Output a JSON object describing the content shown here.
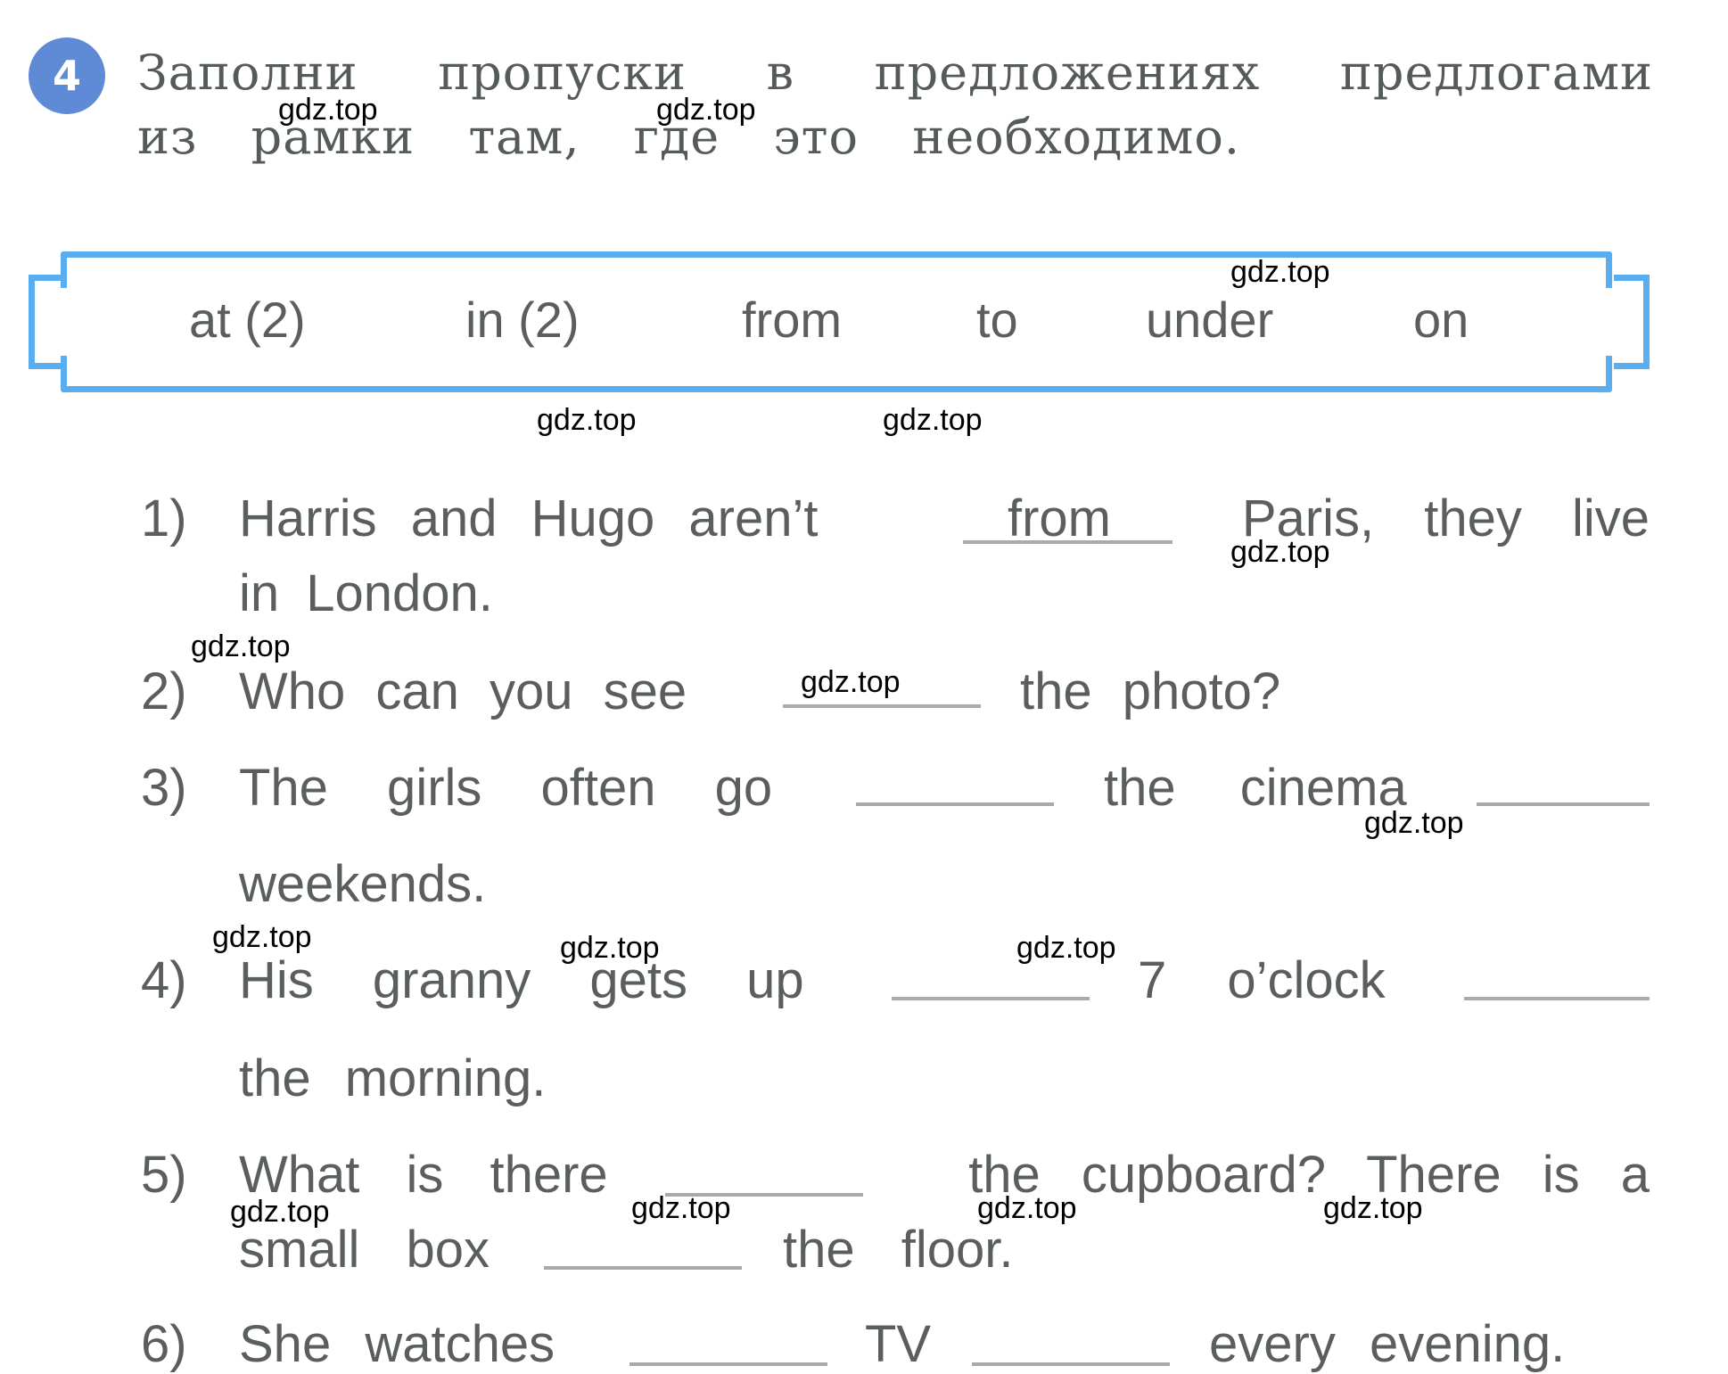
{
  "exercise": {
    "number": "4",
    "instruction_line1": [
      "Заполни",
      "пропуски",
      "в",
      "предложениях",
      "предлогами"
    ],
    "instruction_line2": [
      "из",
      "рамки",
      "там,",
      "где",
      "это",
      "необходимо."
    ]
  },
  "word_box": {
    "words": [
      "at (2)",
      "in (2)",
      "from",
      "to",
      "under",
      "on"
    ]
  },
  "sentences": [
    {
      "num": "1)",
      "line1_a": "Harris and Hugo aren’t",
      "answer": "from",
      "line1_b": "Paris, they live",
      "line2": "in London."
    },
    {
      "num": "2)",
      "line1_a": "Who can you see",
      "line1_b": "the photo?"
    },
    {
      "num": "3)",
      "line1_a": "The girls often go",
      "line1_b": "the cinema",
      "line2": "weekends."
    },
    {
      "num": "4)",
      "line1_a": "His granny gets up",
      "line1_b": "7 o’clock",
      "line2": "the morning."
    },
    {
      "num": "5)",
      "line1_a": "What is there",
      "line1_b": "the cupboard? There is a",
      "line2_a": "small box",
      "line2_b": "the floor."
    },
    {
      "num": "6)",
      "line1_a": "She watches",
      "line1_b": "TV",
      "line1_c": "every evening."
    }
  ],
  "watermark": "gdz.top"
}
